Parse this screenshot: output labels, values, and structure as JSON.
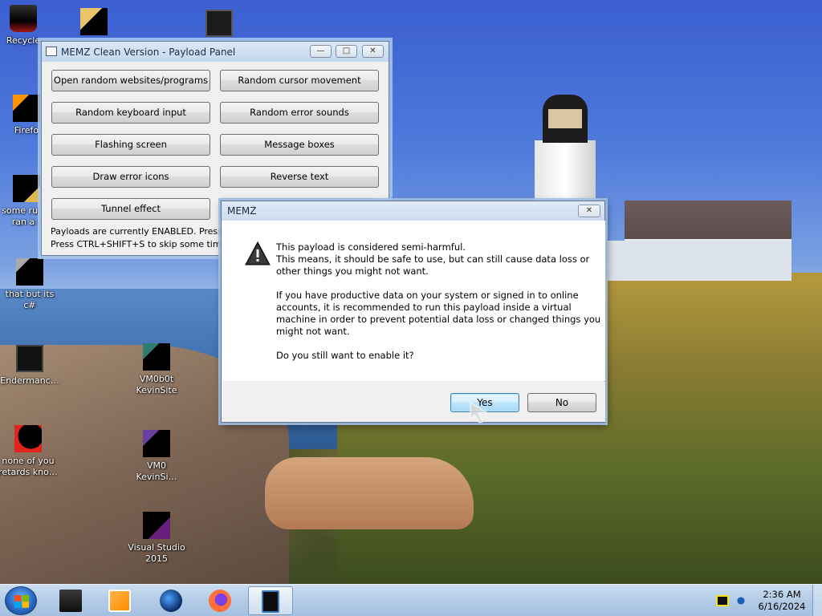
{
  "desktop": {
    "icons": [
      {
        "label": "Recycle",
        "icon": "recycle-bin-icon"
      },
      {
        "label": "",
        "icon": "folder-files-icon"
      },
      {
        "label": "",
        "icon": "app-window-icon"
      },
      {
        "label": "Firefo",
        "icon": "firefox-shortcut-icon"
      },
      {
        "label": "some rus… ran a r",
        "icon": "shortcut-icon"
      },
      {
        "label": "that but its c#",
        "icon": "stacked-windows-icon"
      },
      {
        "label": "Endermanc…",
        "icon": "app-window-icon"
      },
      {
        "label": "VM0b0t KevinSite",
        "icon": "vm-shortcut-icon"
      },
      {
        "label": "none of you retards kno…",
        "icon": "opera-shortcut-icon"
      },
      {
        "label": "VM0 KevinSi…",
        "icon": "vm-shortcut-icon"
      },
      {
        "label": "Visual Studio 2015",
        "icon": "visual-studio-icon"
      }
    ]
  },
  "panel": {
    "title": "MEMZ Clean Version - Payload Panel",
    "caption_minimize": "—",
    "caption_maximize": "□",
    "caption_close": "✕",
    "buttons": [
      "Open random websites/programs",
      "Random cursor movement",
      "Random keyboard input",
      "Random error sounds",
      "Flashing screen",
      "Message boxes",
      "Draw error icons",
      "Reverse text",
      "Tunnel effect",
      ""
    ],
    "status_line1": "Payloads are currently ENABLED. Press SHI",
    "status_line2": "Press CTRL+SHIFT+S to skip some time (mal"
  },
  "dialog": {
    "title": "MEMZ",
    "close_label": "✕",
    "message_p1": "This payload is considered semi-harmful.",
    "message_p2": "This means, it should be safe to use, but can still cause data loss or",
    "message_p3": "other things you might not want.",
    "message_p4": "If you have productive data on your system or signed in to online",
    "message_p5": "accounts, it is recommended to run this payload inside a virtual",
    "message_p6": "machine in order to prevent potential data loss or changed things you",
    "message_p7": "might not want.",
    "message_p8": "Do you still want to enable it?",
    "yes_label": "Yes",
    "no_label": "No",
    "icon": "warning-icon"
  },
  "taskbar": {
    "start": "windows-start-icon",
    "items": [
      "app-window-icon",
      "media-player-icon",
      "globe-icon",
      "firefox-icon",
      "memz-panel-icon"
    ],
    "clock_time": "2:36 AM",
    "clock_date": "6/16/2024"
  }
}
